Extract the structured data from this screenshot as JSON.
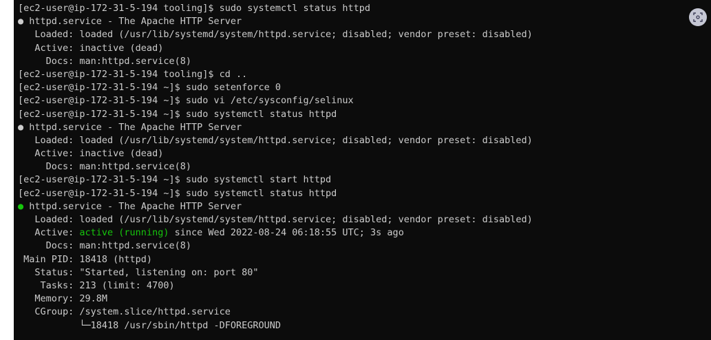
{
  "terminal": {
    "lines": [
      [
        {
          "text": "[ec2-user@ip-172-31-5-194 tooling]$ sudo systemctl status httpd"
        }
      ],
      [
        {
          "text": "● httpd.service - The Apache HTTP Server"
        }
      ],
      [
        {
          "text": "   Loaded: loaded (/usr/lib/systemd/system/httpd.service; disabled; vendor preset: disabled)"
        }
      ],
      [
        {
          "text": "   Active: inactive (dead)"
        }
      ],
      [
        {
          "text": "     Docs: man:httpd.service(8)"
        }
      ],
      [
        {
          "text": "[ec2-user@ip-172-31-5-194 tooling]$ cd .."
        }
      ],
      [
        {
          "text": "[ec2-user@ip-172-31-5-194 ~]$ sudo setenforce 0"
        }
      ],
      [
        {
          "text": "[ec2-user@ip-172-31-5-194 ~]$ sudo vi /etc/sysconfig/selinux"
        }
      ],
      [
        {
          "text": "[ec2-user@ip-172-31-5-194 ~]$ sudo systemctl status httpd"
        }
      ],
      [
        {
          "text": "● httpd.service - The Apache HTTP Server"
        }
      ],
      [
        {
          "text": "   Loaded: loaded (/usr/lib/systemd/system/httpd.service; disabled; vendor preset: disabled)"
        }
      ],
      [
        {
          "text": "   Active: inactive (dead)"
        }
      ],
      [
        {
          "text": "     Docs: man:httpd.service(8)"
        }
      ],
      [
        {
          "text": "[ec2-user@ip-172-31-5-194 ~]$ sudo systemctl start httpd"
        }
      ],
      [
        {
          "text": "[ec2-user@ip-172-31-5-194 ~]$ sudo systemctl status httpd"
        }
      ],
      [
        {
          "text": "●",
          "color": "green"
        },
        {
          "text": " httpd.service - The Apache HTTP Server"
        }
      ],
      [
        {
          "text": "   Loaded: loaded (/usr/lib/systemd/system/httpd.service; disabled; vendor preset: disabled)"
        }
      ],
      [
        {
          "text": "   Active: "
        },
        {
          "text": "active (running)",
          "color": "green"
        },
        {
          "text": " since Wed 2022-08-24 06:18:55 UTC; 3s ago"
        }
      ],
      [
        {
          "text": "     Docs: man:httpd.service(8)"
        }
      ],
      [
        {
          "text": " Main PID: 18418 (httpd)"
        }
      ],
      [
        {
          "text": "   Status: \"Started, listening on: port 80\""
        }
      ],
      [
        {
          "text": "    Tasks: 213 (limit: 4700)"
        }
      ],
      [
        {
          "text": "   Memory: 29.8M"
        }
      ],
      [
        {
          "text": "   CGroup: /system.slice/httpd.service"
        }
      ],
      [
        {
          "text": "           └─18418 /usr/sbin/httpd -DFOREGROUND"
        }
      ]
    ]
  },
  "colors": {
    "background": "#0c0c0c",
    "text": "#cccccc",
    "green": "#16c60c",
    "corner_button": "#c5c7d4"
  },
  "corner_button": {
    "icon": "screen-capture-icon"
  }
}
